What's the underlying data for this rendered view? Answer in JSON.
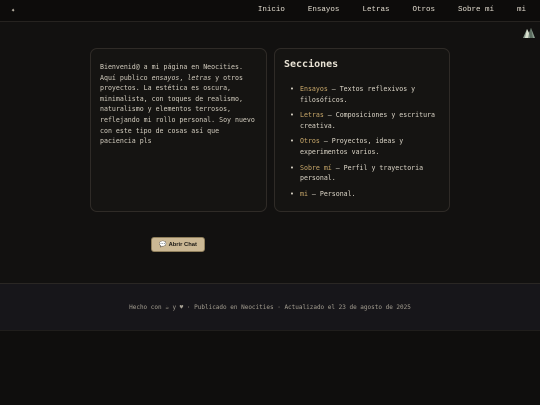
{
  "header": {
    "logo_symbol": "✦",
    "nav": [
      "Inicio",
      "Ensayos",
      "Letras",
      "Otros",
      "Sobre mí",
      "mi"
    ]
  },
  "intro": {
    "p1": "Bienvenid@ a mi página en Neocities. Aquí publico ",
    "em1": "ensayos",
    "p2": ", ",
    "em2": "letras",
    "p3": " y otros proyectos. La estética es oscura, minimalista, con toques de realismo, naturalismo y elementos terrosos, reflejando mi rollo personal. Soy nuevo con este tipo de cosas así que paciencia pls"
  },
  "sections": {
    "title": "Secciones",
    "items": [
      {
        "link": "Ensayos",
        "desc": " — Textos reflexivos y filosóficos."
      },
      {
        "link": "Letras",
        "desc": " — Composiciones y escritura creativa."
      },
      {
        "link": "Otros",
        "desc": " — Proyectos, ideas y experimentos varios."
      },
      {
        "link": "Sobre mí",
        "desc": " — Perfil y trayectoria personal."
      },
      {
        "link": "mi",
        "desc": " — Personal."
      }
    ]
  },
  "chat": {
    "icon": "💬",
    "label": "Abrir Chat"
  },
  "footer": {
    "text": "Hecho con ☕ y ♥ · Publicado en Neocities · Actualizado el 23 de agosto de 2025"
  },
  "colors": {
    "background": "#121110",
    "accent": "#c9a86a",
    "button": "#cbb894"
  }
}
